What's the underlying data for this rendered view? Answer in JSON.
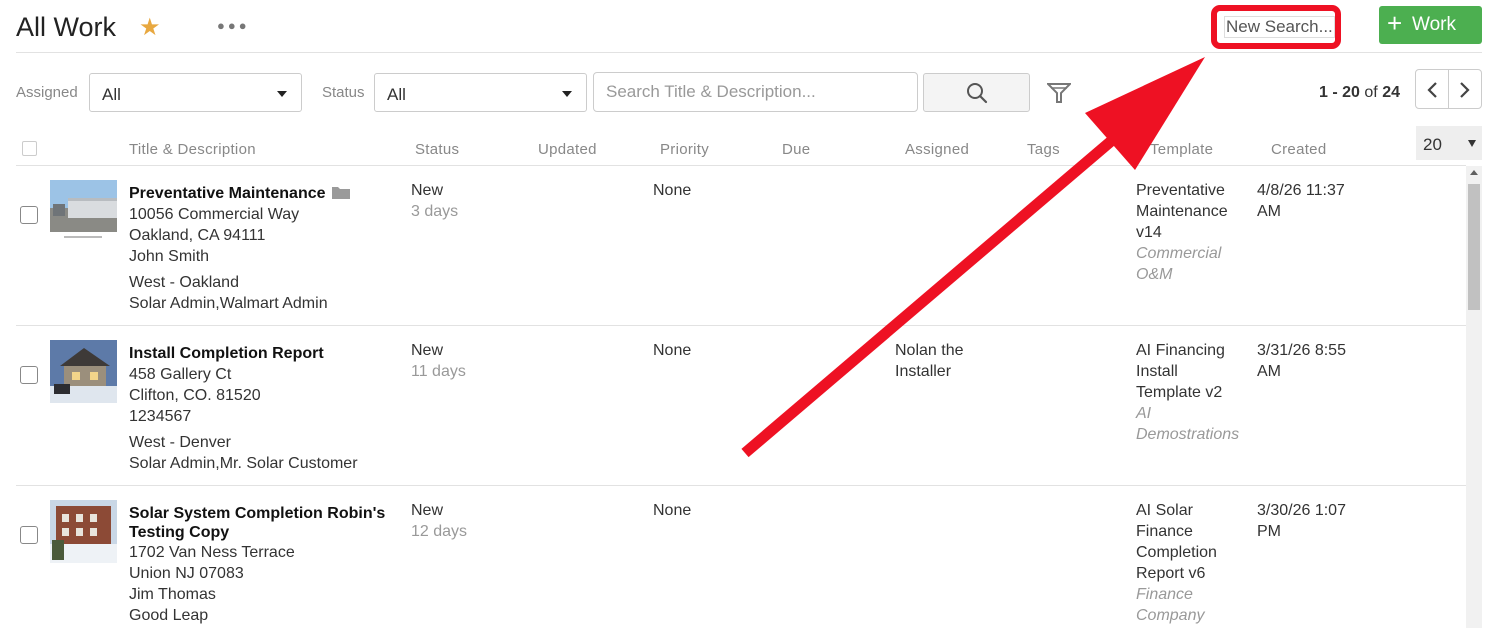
{
  "header": {
    "title": "All Work",
    "star_icon": "★",
    "more_icon": "●●●",
    "new_search_label": "New Search...",
    "add_work_label": "Work",
    "add_icon": "+"
  },
  "filters": {
    "assigned_label": "Assigned",
    "assigned_value": "All",
    "status_label": "Status",
    "status_value": "All",
    "search_placeholder": "Search Title & Description..."
  },
  "pagination": {
    "range": "1 - 20",
    "of": "of",
    "total": "24",
    "page_size": "20"
  },
  "columns": [
    "Title & Description",
    "Status",
    "Updated",
    "Priority",
    "Due",
    "Assigned",
    "Tags",
    "Template",
    "Created"
  ],
  "rows": [
    {
      "title": "Preventative Maintenance",
      "address1": "10056 Commercial Way",
      "address2": "Oakland, CA 94111",
      "contact": "John Smith",
      "region": "West - Oakland",
      "groups": "Solar Admin,Walmart Admin",
      "status": "New",
      "age": "3 days",
      "priority": "None",
      "assigned": "",
      "template_lines": [
        "Preventative",
        "Maintenance",
        "v14"
      ],
      "template_sub_lines": [
        "Commercial",
        "O&M"
      ],
      "created_lines": [
        "4/8/26 11:37",
        "AM"
      ]
    },
    {
      "title": "Install Completion Report",
      "address1": "458 Gallery Ct",
      "address2": "Clifton, CO. 81520",
      "contact": "1234567",
      "region": "West - Denver",
      "groups": "Solar Admin,Mr. Solar Customer",
      "status": "New",
      "age": "11 days",
      "priority": "None",
      "assigned_lines": [
        "Nolan the",
        "Installer"
      ],
      "template_lines": [
        "AI Financing",
        "Install",
        "Template v2"
      ],
      "template_sub_lines": [
        "AI",
        "Demostrations"
      ],
      "created_lines": [
        "3/31/26 8:55",
        "AM"
      ]
    },
    {
      "title_lines": [
        "Solar System Completion Robin's",
        "Testing Copy"
      ],
      "address1": "1702 Van Ness Terrace",
      "address2": "Union NJ 07083",
      "contact": "Jim Thomas",
      "groups": "Good Leap",
      "status": "New",
      "age": "12 days",
      "priority": "None",
      "template_lines": [
        "AI Solar",
        "Finance",
        "Completion",
        "Report v6"
      ],
      "template_sub_lines": [
        "Finance",
        "Company"
      ],
      "created_lines": [
        "3/30/26 1:07",
        "PM"
      ]
    }
  ],
  "colors": {
    "accent_green": "#4caf50",
    "highlight_red": "#ee1123",
    "star": "#e8a840"
  }
}
